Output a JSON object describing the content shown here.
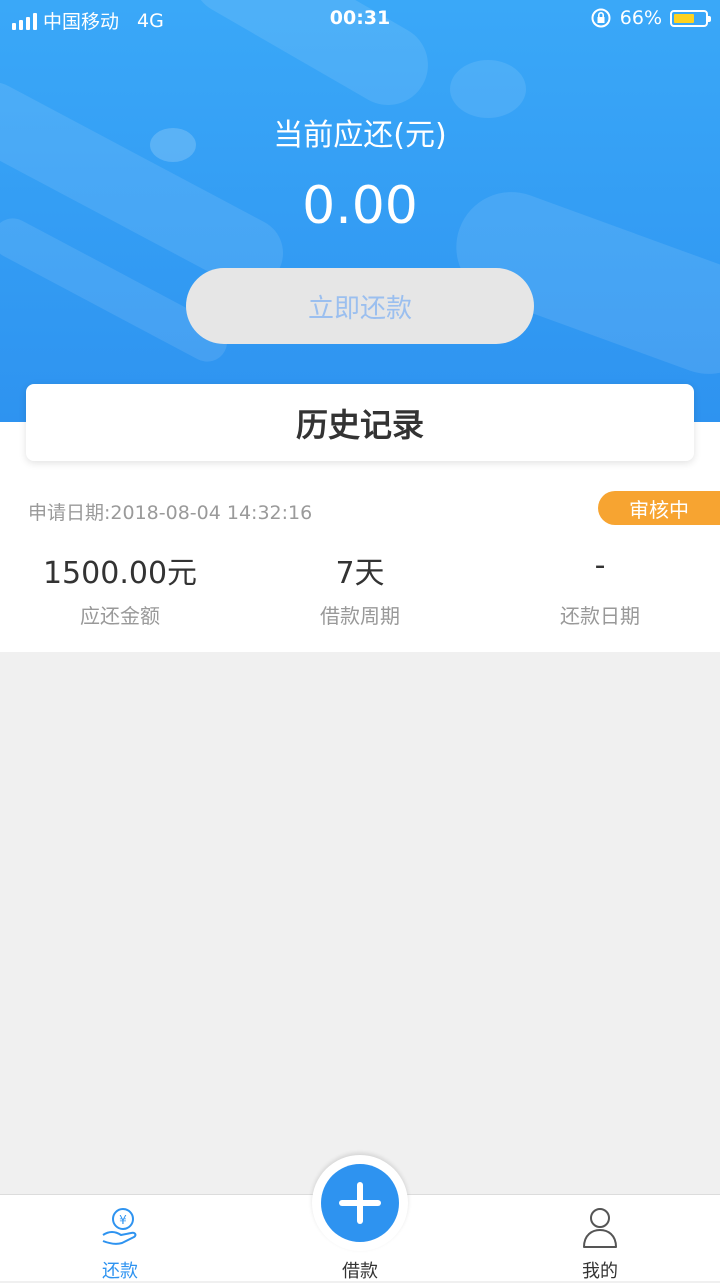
{
  "status_bar": {
    "carrier": "中国移动",
    "network": "4G",
    "time": "00:31",
    "battery": "66%",
    "battery_level": 0.66
  },
  "summary": {
    "title": "当前应还(元)",
    "amount": "0.00",
    "repay_button": "立即还款"
  },
  "history": {
    "title": "历史记录"
  },
  "record": {
    "apply_date": "申请日期:2018-08-04 14:32:16",
    "status": "审核中",
    "amount_value": "1500.00元",
    "amount_label": "应还金额",
    "period_value": "7天",
    "period_label": "借款周期",
    "repay_date_value": "-",
    "repay_date_label": "还款日期"
  },
  "tabs": {
    "repay": "还款",
    "borrow": "借款",
    "mine": "我的"
  },
  "colors": {
    "primary": "#2e93f0",
    "badge": "#f7a431",
    "battery": "#ffd21f"
  },
  "icons": [
    "signal-icon",
    "lock-rotation-icon",
    "battery-icon",
    "repay-hand-icon",
    "plus-icon",
    "user-icon"
  ]
}
